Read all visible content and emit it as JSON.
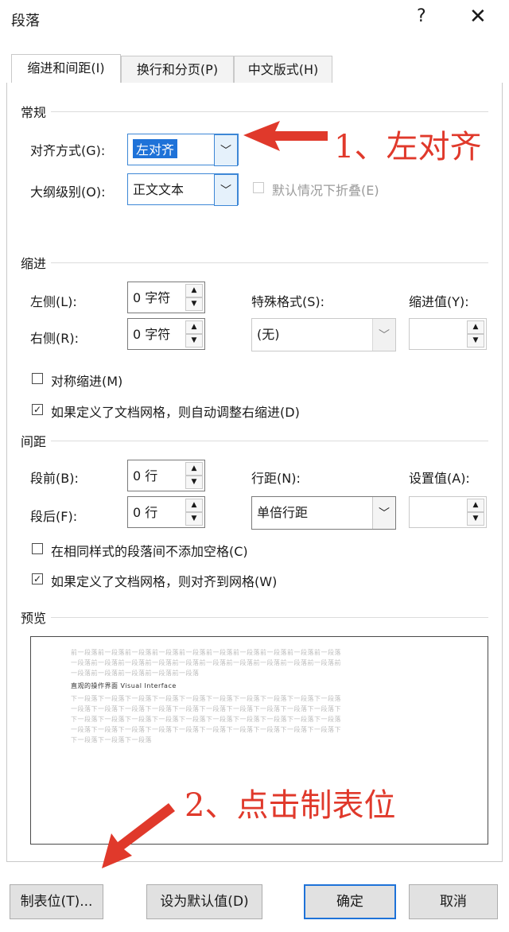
{
  "window": {
    "title": "段落",
    "help": "?",
    "close": "✕"
  },
  "tabs": [
    {
      "label": "缩进和间距(I)"
    },
    {
      "label": "换行和分页(P)"
    },
    {
      "label": "中文版式(H)"
    }
  ],
  "general": {
    "title": "常规",
    "alignment_label": "对齐方式(G):",
    "alignment_value": "左对齐",
    "outline_label": "大纲级别(O):",
    "outline_value": "正文文本",
    "collapse_label": "默认情况下折叠(E)"
  },
  "indent": {
    "title": "缩进",
    "left_label": "左侧(L):",
    "left_value": "0 字符",
    "right_label": "右侧(R):",
    "right_value": "0 字符",
    "special_label": "特殊格式(S):",
    "special_value": "(无)",
    "indent_by_label": "缩进值(Y):",
    "mirror_label": "对称缩进(M)",
    "auto_adjust_label": "如果定义了文档网格，则自动调整右缩进(D)"
  },
  "spacing": {
    "title": "间距",
    "before_label": "段前(B):",
    "before_value": "0 行",
    "after_label": "段后(F):",
    "after_value": "0 行",
    "line_label": "行距(N):",
    "line_value": "单倍行距",
    "at_label": "设置值(A):",
    "no_space_label": "在相同样式的段落间不添加空格(C)",
    "snap_grid_label": "如果定义了文档网格，则对齐到网格(W)"
  },
  "preview": {
    "title": "预览",
    "lines_before": [
      "前一段落前一段落前一段落前一段落前一段落前一段落前一段落前一段落前一段落前一段落",
      "一段落前一段落前一段落前一段落前一段落前一段落前一段落前一段落前一段落前一段落前",
      "一段落前一段落前一段落前一段落前一段落"
    ],
    "main_line": "直观的操作界面 Visual Interface",
    "lines_after": [
      "下一段落下一段落下一段落下一段落下一段落下一段落下一段落下一段落下一段落下一段落",
      "一段落下一段落下一段落下一段落下一段落下一段落下一段落下一段落下一段落下一段落下",
      "下一段落下一段落下一段落下一段落下一段落下一段落下一段落下一段落下一段落下一段落",
      "一段落下一段落下一段落下一段落下一段落下一段落下一段落下一段落下一段落下一段落下",
      "下一段落下一段落下一段落"
    ]
  },
  "buttons": {
    "tabs": "制表位(T)...",
    "set_default": "设为默认值(D)",
    "ok": "确定",
    "cancel": "取消"
  },
  "annotations": {
    "first": "1、左对齐",
    "second": "2、点击制表位",
    "color": "#e0392b"
  },
  "checks": {
    "mirror": "",
    "auto_adjust": "✓",
    "no_space": "",
    "snap_grid": "✓"
  }
}
